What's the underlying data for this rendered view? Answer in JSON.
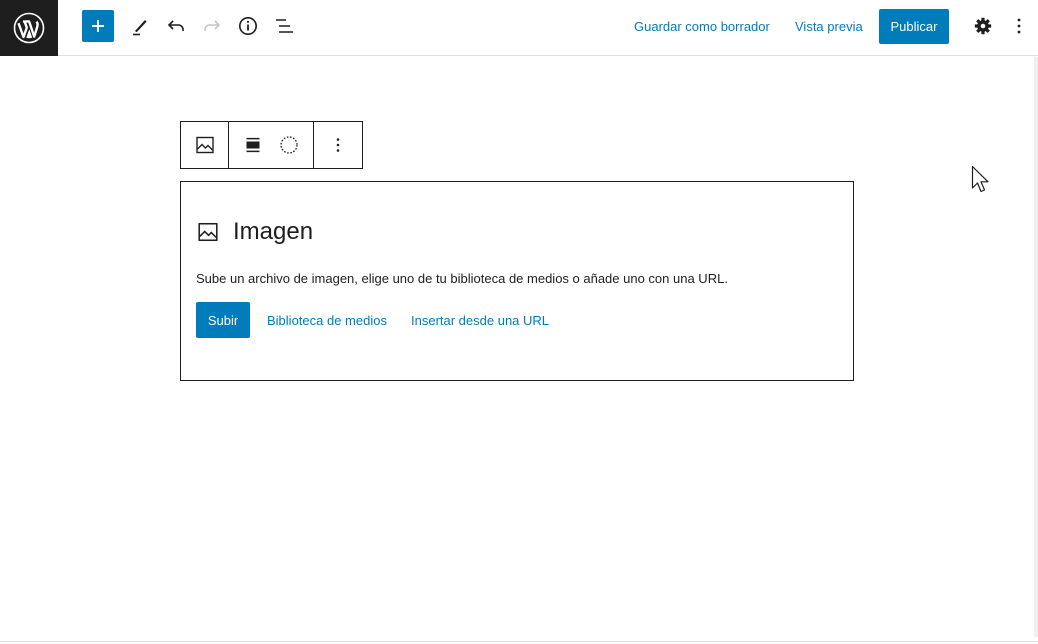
{
  "header": {
    "logo_name": "wordpress-logo",
    "add_block_icon": "plus-icon",
    "tools_icon": "pencil-icon",
    "undo_icon": "undo-icon",
    "redo_icon": "redo-icon",
    "details_icon": "info-icon",
    "outline_icon": "list-view-icon",
    "save_draft_label": "Guardar como borrador",
    "preview_label": "Vista previa",
    "publish_label": "Publicar",
    "settings_icon": "gear-icon",
    "more_icon": "more-vertical-icon"
  },
  "block_toolbar": {
    "block_type_icon": "image-icon",
    "align_icon": "align-center-icon",
    "duotone_icon": "dashed-circle-icon",
    "options_icon": "more-vertical-icon"
  },
  "image_block": {
    "title": "Imagen",
    "description": "Sube un archivo de imagen, elige uno de tu biblioteca de medios o añade uno con una URL.",
    "upload_label": "Subir",
    "media_library_label": "Biblioteca de medios",
    "insert_url_label": "Insertar desde una URL"
  },
  "colors": {
    "accent": "#007cba",
    "dark": "#1e1e1e"
  }
}
